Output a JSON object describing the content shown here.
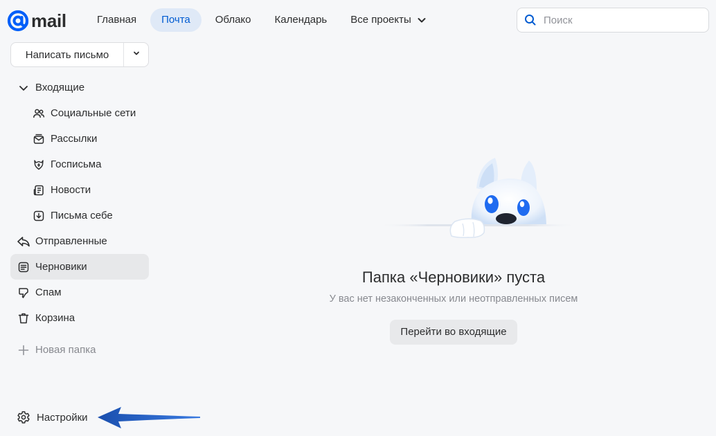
{
  "logo": {
    "text": "mail"
  },
  "nav": {
    "items": [
      {
        "label": "Главная"
      },
      {
        "label": "Почта",
        "active": true
      },
      {
        "label": "Облако"
      },
      {
        "label": "Календарь"
      },
      {
        "label": "Все проекты"
      }
    ]
  },
  "search": {
    "placeholder": "Поиск"
  },
  "compose": {
    "label": "Написать письмо"
  },
  "sidebar": {
    "items": [
      {
        "label": "Входящие",
        "icon": "chevron-down-icon"
      },
      {
        "label": "Социальные сети",
        "icon": "people-icon"
      },
      {
        "label": "Рассылки",
        "icon": "newsletter-icon"
      },
      {
        "label": "Госписьма",
        "icon": "emblem-icon"
      },
      {
        "label": "Новости",
        "icon": "news-icon"
      },
      {
        "label": "Письма себе",
        "icon": "download-icon"
      },
      {
        "label": "Отправленные",
        "icon": "sent-icon"
      },
      {
        "label": "Черновики",
        "icon": "draft-icon",
        "active": true
      },
      {
        "label": "Спам",
        "icon": "spam-icon"
      },
      {
        "label": "Корзина",
        "icon": "trash-icon"
      }
    ],
    "new_folder": "Новая папка",
    "settings": "Настройки"
  },
  "empty_state": {
    "title": "Папка «Черновики» пуста",
    "subtitle": "У вас нет незаконченных или неотправленных писем",
    "button": "Перейти во входящие"
  },
  "colors": {
    "accent": "#005bd1",
    "nav_active_bg": "#dfe9f7",
    "background": "#f6f7f9",
    "annotation_arrow": "#1a5cc2"
  }
}
